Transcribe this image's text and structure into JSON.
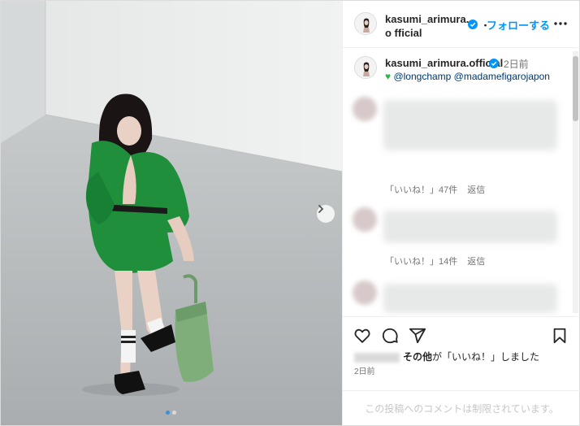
{
  "post": {
    "username": "kasumi_arimura.official",
    "username_wrapped": "kasumi_arimura.o fficial",
    "follow_separator": "・",
    "follow_label": "フォローする",
    "more_icon": "more-horizontal-icon",
    "carousel": {
      "current": 1,
      "total": 2
    }
  },
  "caption": {
    "username": "kasumi_arimura.official",
    "time": "2日前",
    "heart_icon": "green-heart-emoji",
    "text": " @longchamp @madamefigarojapon"
  },
  "comments": [
    {
      "likes": "「いいね！」47件",
      "reply": "返信"
    },
    {
      "likes": "「いいね！」14件",
      "reply": "返信"
    }
  ],
  "actions": {
    "like_icon": "heart-icon",
    "comment_icon": "comment-icon",
    "share_icon": "send-icon",
    "save_icon": "bookmark-icon",
    "others": "その他",
    "liked_suffix": "が「いいね！」しました",
    "time": "2日前",
    "restricted": "この投稿へのコメントは制限されています。"
  },
  "colors": {
    "accent": "#0095f6",
    "dress": "#1f8f3c",
    "verified": "#0095f6"
  }
}
